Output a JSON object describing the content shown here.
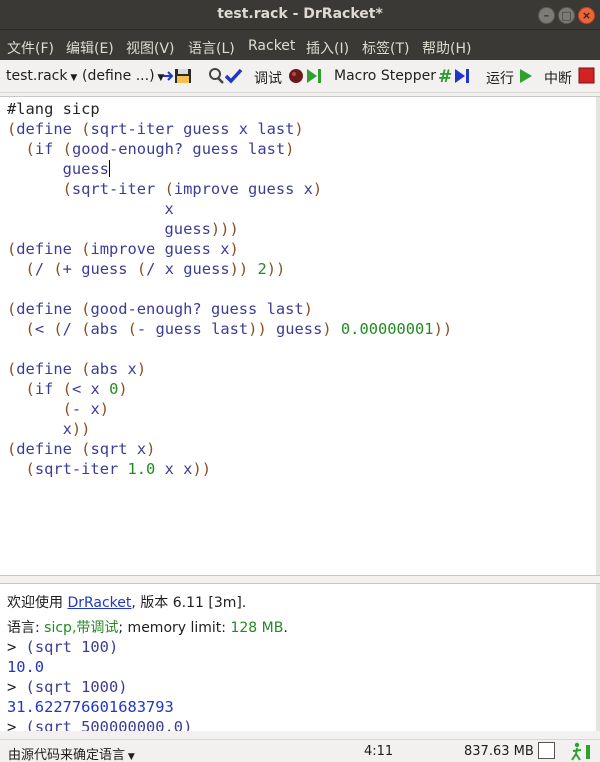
{
  "window": {
    "title": "test.rack - DrRacket*",
    "controls": [
      "minimize",
      "maximize",
      "close"
    ]
  },
  "menubar": [
    "文件(F)",
    "编辑(E)",
    "视图(V)",
    "语言(L)",
    "Racket",
    "插入(I)",
    "标签(T)",
    "帮助(H)"
  ],
  "toolbar": {
    "file_selector": "test.rack",
    "define_selector": "(define ...)",
    "debug_label": "调试",
    "macro_stepper_label": "Macro Stepper",
    "run_label": "运行",
    "break_label": "中断"
  },
  "editor": {
    "lines": [
      "#lang sicp",
      "(define (sqrt-iter guess x last)",
      "  (if (good-enough? guess last)",
      "      guess",
      "      (sqrt-iter (improve guess x)",
      "                 x",
      "                 guess)))",
      "(define (improve guess x)",
      "  (/ (+ guess (/ x guess)) 2))",
      "",
      "(define (good-enough? guess last)",
      "  (< (/ (abs (- guess last)) guess) 0.00000001))",
      "",
      "(define (abs x)",
      "  (if (< x 0)",
      "      (- x)",
      "      x))",
      "(define (sqrt x)",
      "  (sqrt-iter 1.0 x x))"
    ]
  },
  "interactions": {
    "welcome_prefix": "欢迎使用 ",
    "welcome_link": "DrRacket",
    "welcome_suffix": ", 版本 6.11 [3m].",
    "language_prefix": "语言: ",
    "language_value": "sicp,带调试",
    "memory_prefix": "; memory limit: ",
    "memory_value": "128 MB",
    "memory_suffix": ".",
    "entries": [
      {
        "prompt": "> ",
        "input": "(sqrt 100)",
        "output": "10.0"
      },
      {
        "prompt": "> ",
        "input": "(sqrt 1000)",
        "output": "31.622776601683793"
      },
      {
        "prompt": "> ",
        "input": "(sqrt 500000000.0)",
        "output": ""
      }
    ]
  },
  "statusbar": {
    "language_selector": "由源代码来确定语言",
    "position": "4:11",
    "memory": "837.63 MB"
  }
}
